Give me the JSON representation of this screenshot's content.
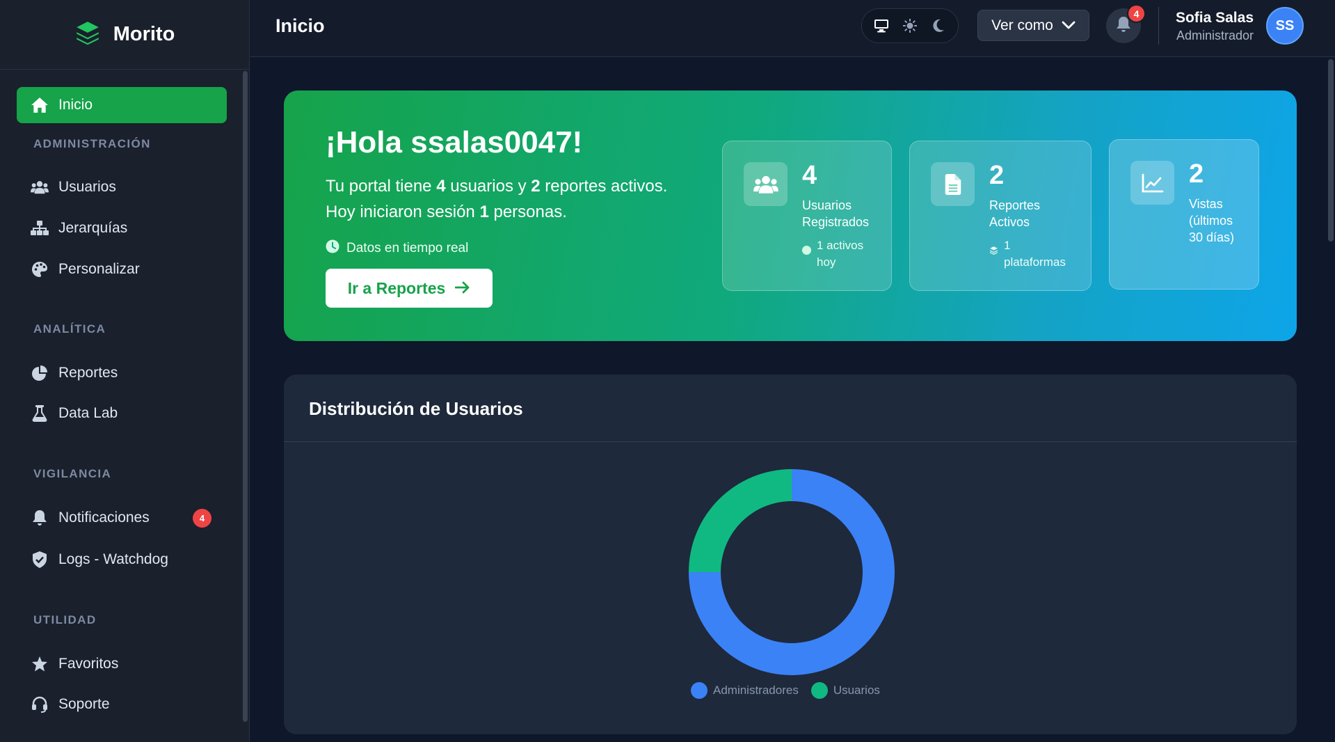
{
  "app": {
    "name": "Morito",
    "brand_color": "#22c55e"
  },
  "sidebar": {
    "active_color": "#16a34a",
    "items": [
      {
        "label": "Inicio",
        "icon": "home-icon"
      },
      {
        "label": "Usuarios",
        "icon": "users-icon"
      },
      {
        "label": "Jerarquías",
        "icon": "sitemap-icon"
      },
      {
        "label": "Personalizar",
        "icon": "palette-icon"
      },
      {
        "label": "Reportes",
        "icon": "chart-pie-icon"
      },
      {
        "label": "Data Lab",
        "icon": "flask-icon"
      },
      {
        "label": "Notificaciones",
        "icon": "bell-icon",
        "badge": "4"
      },
      {
        "label": "Logs - Watchdog",
        "icon": "shield-icon"
      },
      {
        "label": "Favoritos",
        "icon": "star-icon"
      },
      {
        "label": "Soporte",
        "icon": "headset-icon"
      }
    ],
    "sections": [
      "ADMINISTRACIÓN",
      "ANALÍTICA",
      "VIGILANCIA",
      "UTILIDAD"
    ]
  },
  "header": {
    "title": "Inicio",
    "theme_buttons": [
      "desktop-icon",
      "sun-icon",
      "moon-icon"
    ],
    "view_as": "Ver como",
    "notification_count": "4",
    "user": {
      "name": "Sofia Salas",
      "role": "Administrador",
      "initials": "SS"
    }
  },
  "hero": {
    "greeting": "¡Hola ssalas0047!",
    "line1": {
      "pre": "Tu portal tiene ",
      "users": "4",
      "mid": " usuarios y ",
      "reports": "2",
      "post": " reportes activos."
    },
    "line2": {
      "pre": "Hoy iniciaron sesión ",
      "count": "1",
      "post": " personas."
    },
    "live_text": "Datos en tiempo real",
    "cta": "Ir a Reportes",
    "stats": [
      {
        "value": "4",
        "label1": "Usuarios",
        "label2": "Registrados",
        "sub1": "1 activos",
        "sub2": "hoy",
        "icon": "users-icon"
      },
      {
        "value": "2",
        "label1": "Reportes",
        "label2": "Activos",
        "sub1": "1",
        "sub2": "plataformas",
        "icon": "file-icon"
      },
      {
        "value": "2",
        "label1": "Vistas",
        "label2": "(últimos",
        "label3": "30 días)",
        "icon": "chart-line-icon"
      }
    ]
  },
  "chart_card": {
    "title": "Distribución de Usuarios"
  },
  "chart_data": {
    "type": "pie",
    "variant": "doughnut",
    "title": "",
    "categories": [
      "Administradores",
      "Usuarios"
    ],
    "values": [
      3,
      1
    ],
    "colors": [
      "#3b82f6",
      "#10b981"
    ],
    "legend": "bottom"
  }
}
